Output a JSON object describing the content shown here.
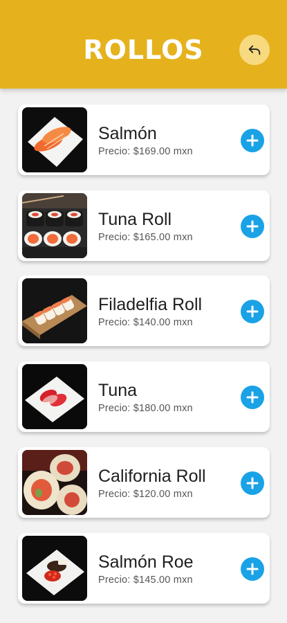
{
  "header": {
    "title": "ROLLOS",
    "back_icon": "back-arrow-icon",
    "accent_color": "#e5b21e"
  },
  "products": [
    {
      "name": "Salmón",
      "price": "Precio: $169.00 mxn",
      "image": "salmon-nigiri",
      "action_icon": "plus-circle-icon"
    },
    {
      "name": "Tuna Roll",
      "price": "Precio: $165.00 mxn",
      "image": "tuna-roll",
      "action_icon": "plus-circle-icon"
    },
    {
      "name": "Filadelfia Roll",
      "price": "Precio: $140.00 mxn",
      "image": "filadelfia-roll",
      "action_icon": "plus-circle-icon"
    },
    {
      "name": "Tuna",
      "price": "Precio: $180.00 mxn",
      "image": "tuna-nigiri",
      "action_icon": "plus-circle-icon"
    },
    {
      "name": "California Roll",
      "price": "Precio: $120.00 mxn",
      "image": "california-roll",
      "action_icon": "plus-circle-icon"
    },
    {
      "name": "Salmón Roe",
      "price": "Precio: $145.00 mxn",
      "image": "salmon-roe",
      "action_icon": "plus-circle-icon"
    }
  ],
  "colors": {
    "add_button": "#1aa2e6",
    "card_background": "#ffffff",
    "page_background": "#f2f2f2"
  }
}
